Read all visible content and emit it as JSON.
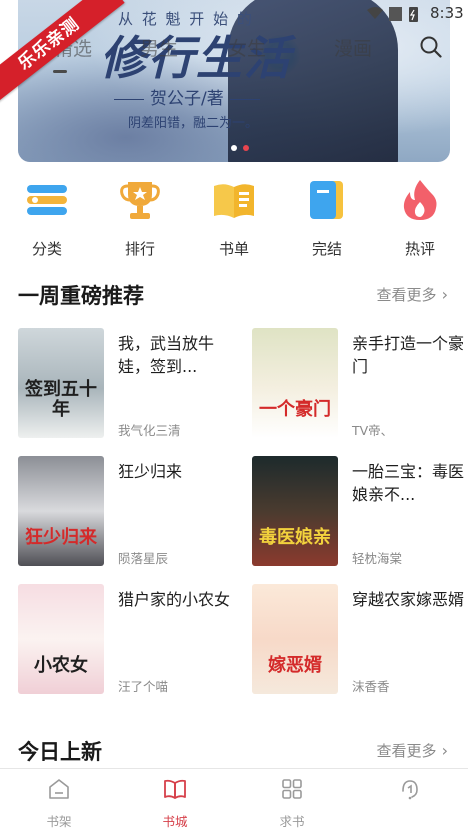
{
  "status_bar": {
    "time": "8:33"
  },
  "promo_ribbon": {
    "text": "乐乐亲测"
  },
  "banner": {
    "top_text": "从 花 魁 开 始 的",
    "title": "修行生活",
    "author": "贺公子/著",
    "slogan": "阴差阳错，融二为一。"
  },
  "top_tabs": [
    {
      "label": "精选"
    },
    {
      "label": "男生"
    },
    {
      "label": "女生"
    },
    {
      "label": "漫画"
    }
  ],
  "categories": [
    {
      "label": "分类",
      "icon": "list-icon"
    },
    {
      "label": "排行",
      "icon": "trophy-icon"
    },
    {
      "label": "书单",
      "icon": "book-open-icon"
    },
    {
      "label": "完结",
      "icon": "notebook-icon"
    },
    {
      "label": "热评",
      "icon": "flame-icon"
    }
  ],
  "weekly": {
    "title": "一周重磅推荐",
    "more": "查看更多",
    "books": [
      {
        "title": "我，武当放牛娃，签到...",
        "author": "我气化三清",
        "cover_text": "签到五十年"
      },
      {
        "title": "亲手打造一个豪门",
        "author": "TV帝、",
        "cover_text": "一个豪门"
      },
      {
        "title": "狂少归来",
        "author": "陨落星辰",
        "cover_text": "狂少归来"
      },
      {
        "title": "一胎三宝：毒医娘亲不...",
        "author": "轻枕海棠",
        "cover_text": "毒医娘亲"
      },
      {
        "title": "猎户家的小农女",
        "author": "汪了个喵",
        "cover_text": "小农女"
      },
      {
        "title": "穿越农家嫁恶婿",
        "author": "沫香香",
        "cover_text": "嫁恶婿"
      }
    ]
  },
  "today": {
    "title": "今日上新",
    "more": "查看更多"
  },
  "bottom_nav": [
    {
      "label": "书架",
      "icon": "bookshelf-icon"
    },
    {
      "label": "书城",
      "icon": "book-icon",
      "active": true
    },
    {
      "label": "求书",
      "icon": "grid-icon"
    },
    {
      "label": "",
      "icon": "headset-icon"
    }
  ]
}
